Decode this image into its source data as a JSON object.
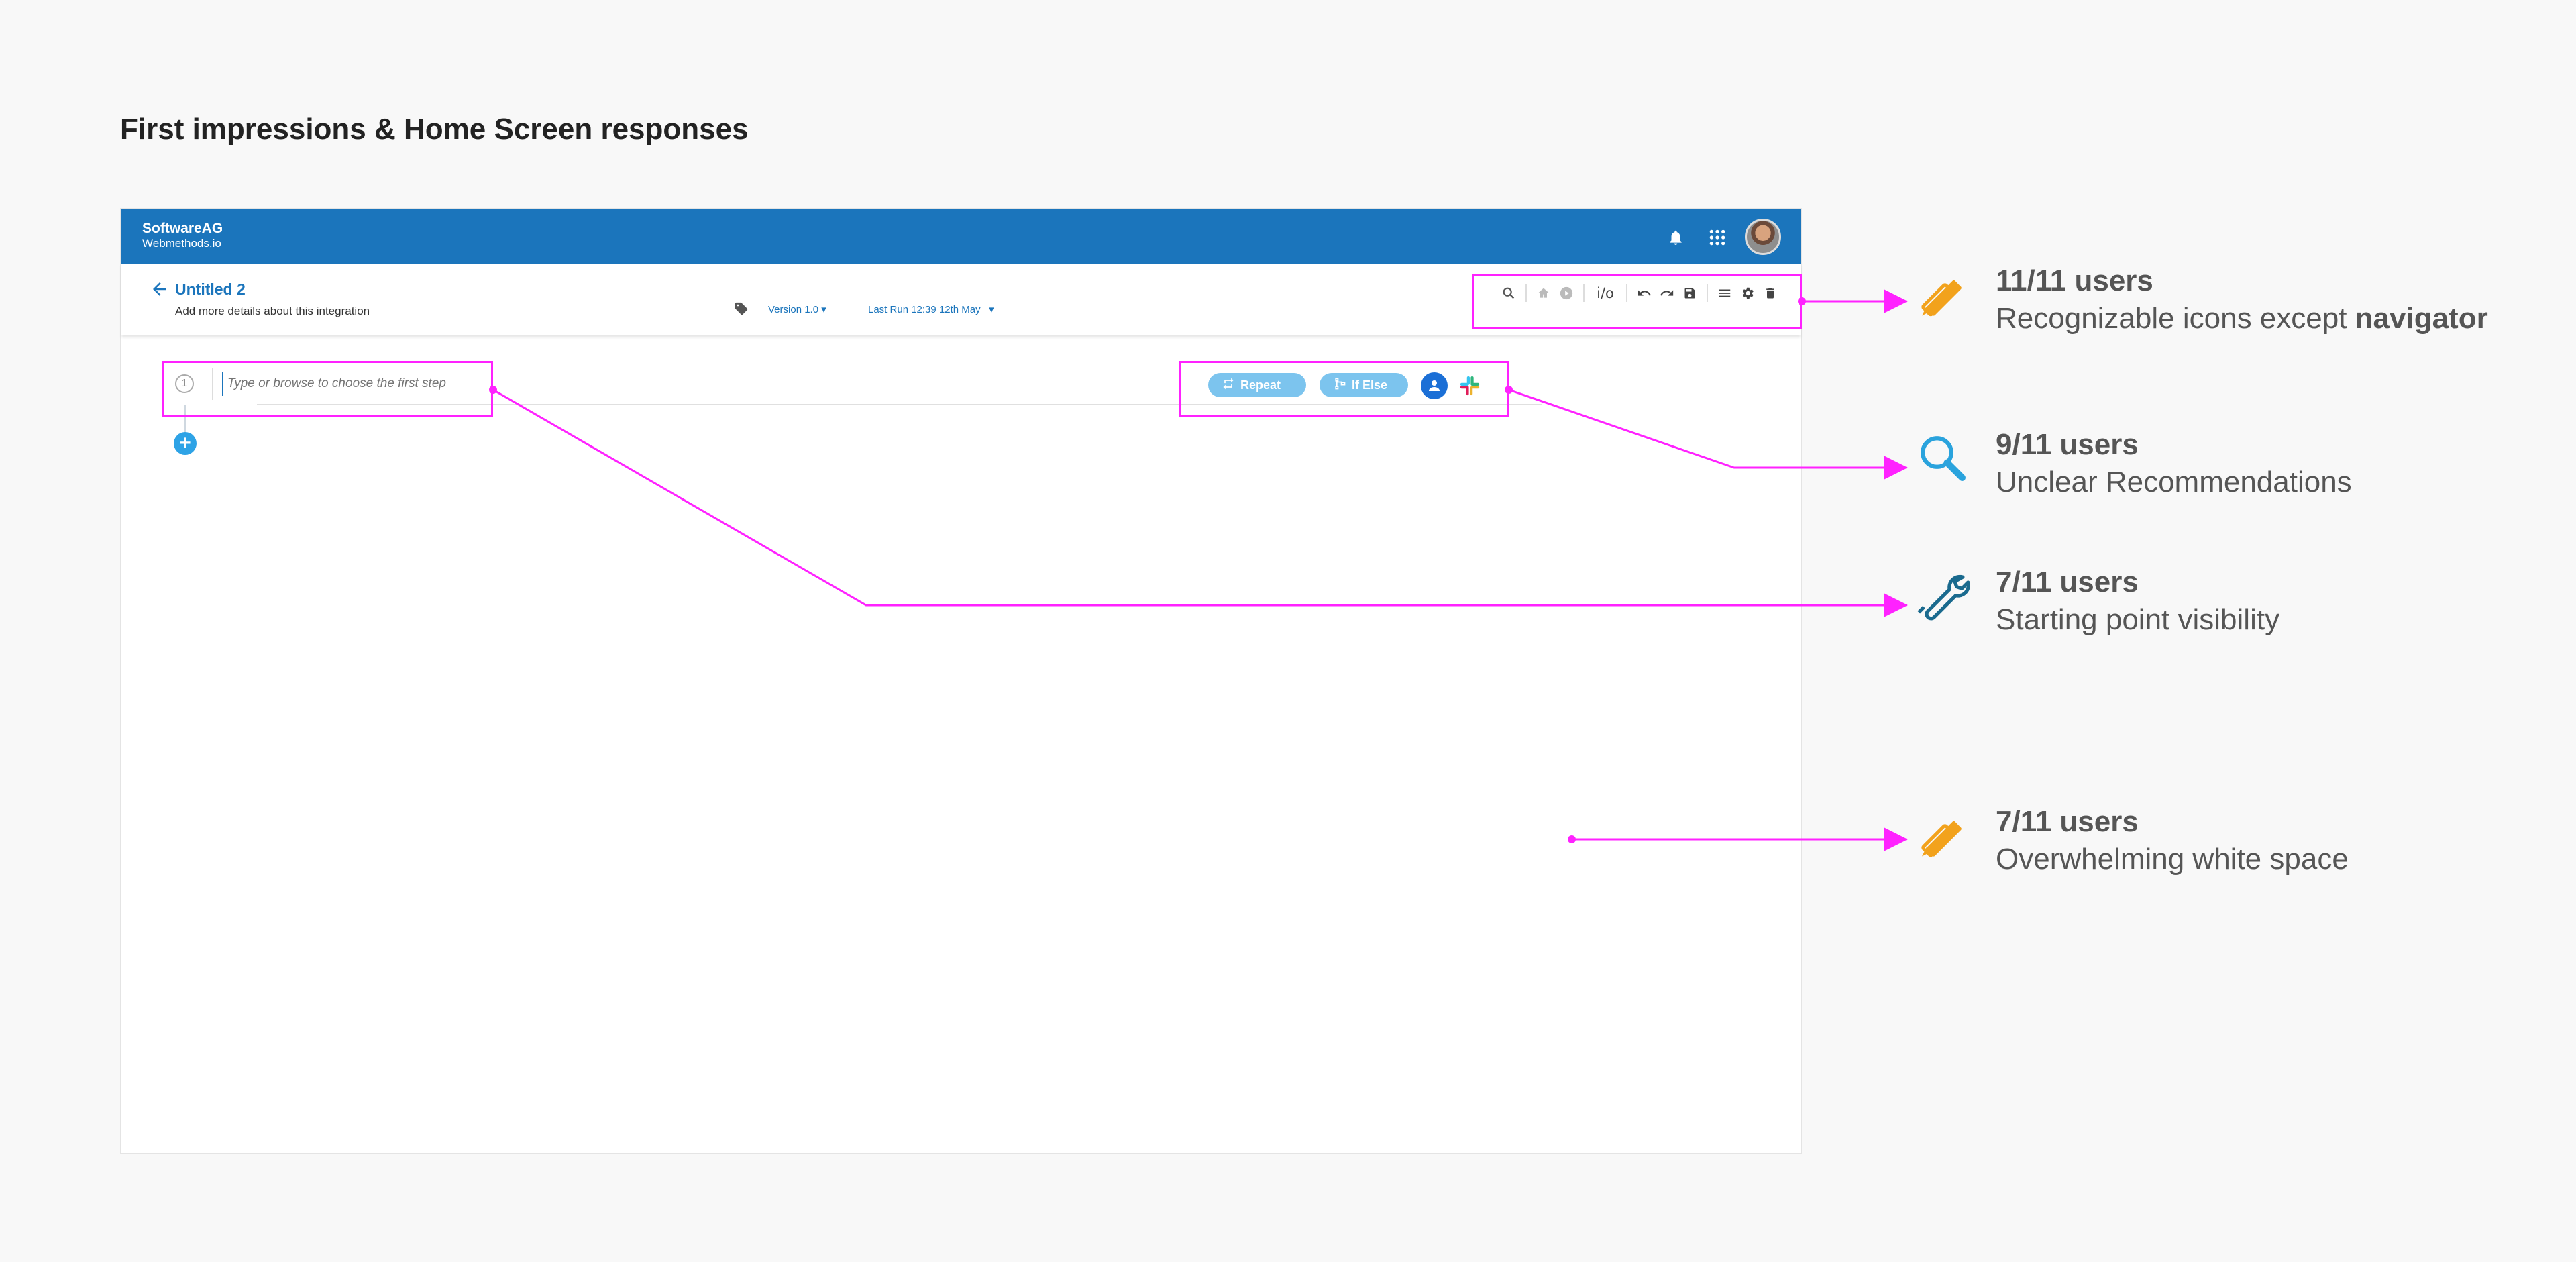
{
  "page": {
    "title": "First impressions & Home Screen responses"
  },
  "app": {
    "brand_line1": "SoftwareAG",
    "brand_line2": "Webmethods.io",
    "header_icons": [
      "bell-icon",
      "apps-grid-icon"
    ],
    "integration": {
      "title": "Untitled 2",
      "description": "Add more details about this integration",
      "version": "Version 1.0",
      "last_run": "Last Run 12:39  12th May"
    },
    "toolbar": {
      "io_label": "i/o",
      "icons": [
        "search-icon",
        "home-icon",
        "play-icon",
        "io-icon",
        "undo-icon",
        "redo-icon",
        "save-icon",
        "menu-icon",
        "gear-icon",
        "trash-icon"
      ]
    },
    "step": {
      "number": "1",
      "placeholder": "Type or browse to choose the first step",
      "repeat_label": "Repeat",
      "ifelse_label": "If Else"
    }
  },
  "colors": {
    "header": "#1b75bc",
    "annotation": "#ff22ff",
    "pill": "#7cc4ee",
    "accent_orange": "#f2a21c",
    "accent_blue": "#2aa3dd"
  },
  "findings": [
    {
      "count": "11/11 users",
      "text": "Recognizable icons except ",
      "bold": "navigator",
      "icon": "pencil-ruler-icon"
    },
    {
      "count": "9/11 users",
      "text": "Unclear Recommendations",
      "bold": "",
      "icon": "magnifier-icon"
    },
    {
      "count": "7/11 users",
      "text": "Starting point visibility",
      "bold": "",
      "icon": "wrench-icon"
    },
    {
      "count": "7/11 users",
      "text": "Overwhelming white space",
      "bold": "",
      "icon": "pencil-ruler-icon"
    }
  ]
}
